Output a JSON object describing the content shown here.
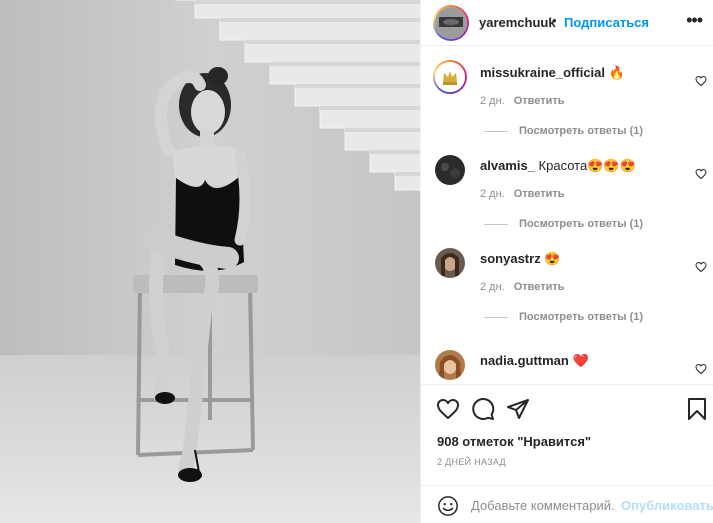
{
  "photo": {
    "alt": ""
  },
  "header": {
    "username": "yaremchuuk",
    "separator": "•",
    "follow_label": "Подписаться",
    "more_icon": "more-horizontal-icon"
  },
  "comments": [
    {
      "user": "missukraine_official",
      "text": " 🔥",
      "time": "2 дн.",
      "reply_label": "Ответить",
      "replies_label": "Посмотреть ответы (1)"
    },
    {
      "user": "alvamis_",
      "text": " Красота😍😍😍",
      "time": "2 дн.",
      "reply_label": "Ответить",
      "replies_label": "Посмотреть ответы (1)"
    },
    {
      "user": "sonyastrz",
      "text": " 😍",
      "time": "2 дн.",
      "reply_label": "Ответить",
      "replies_label": "Посмотреть ответы (1)"
    },
    {
      "user": "nadia.guttman",
      "text": " ❤️",
      "time": "",
      "reply_label": "",
      "replies_label": ""
    }
  ],
  "actions": {
    "like_icon": "heart-icon",
    "comment_icon": "comment-icon",
    "share_icon": "send-icon",
    "save_icon": "bookmark-icon"
  },
  "likes_text": "908 отметок \"Нравится\"",
  "date_text": "2 ДНЕЙ НАЗАД",
  "add_comment": {
    "placeholder": "Добавьте комментарий...",
    "publish_label": "Опубликовать"
  },
  "colors": {
    "accent": "#0095f6",
    "muted": "#8e8e8e",
    "publish_disabled": "#b2dffc"
  }
}
